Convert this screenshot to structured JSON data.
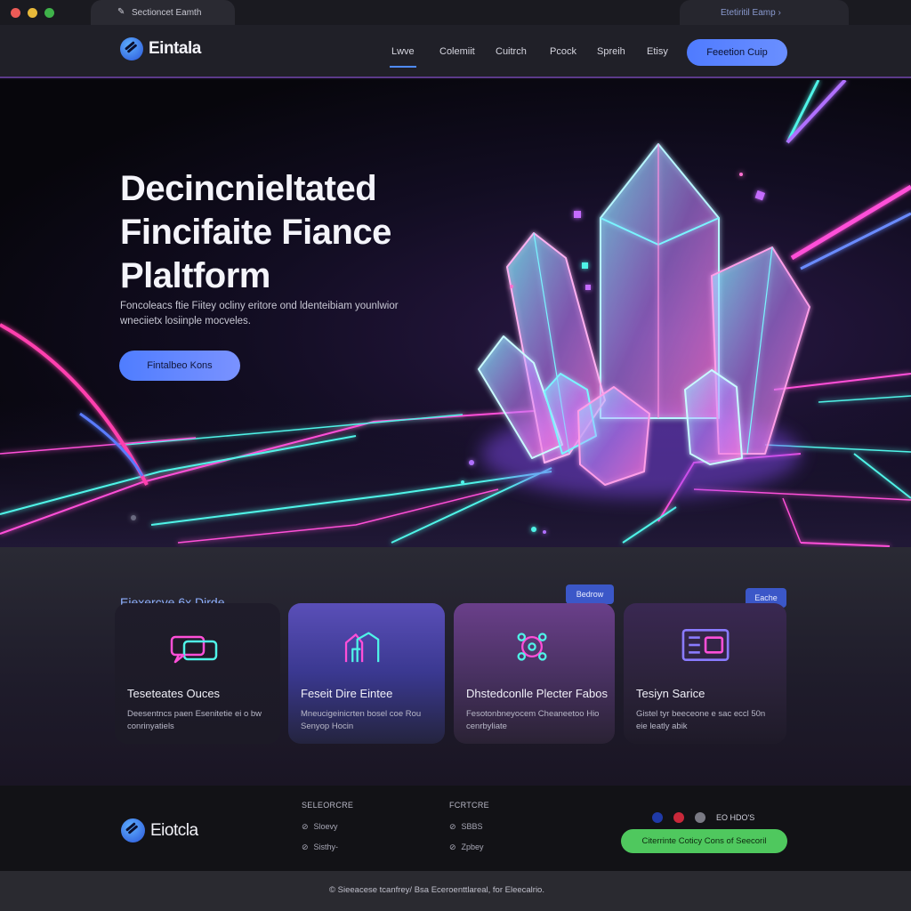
{
  "browser": {
    "tab_title": "Sectioncet Eamth",
    "tab_right": "Etetiritil Eamp"
  },
  "nav": {
    "brand": "Eintala",
    "links": [
      "Lwve",
      "Colemiit",
      "Cuitrch",
      "Pcock",
      "Spreih",
      "Etisy"
    ],
    "active_index": 0,
    "cta": "Feeetion Cuip"
  },
  "hero": {
    "title_lines": [
      "Decincnieltated",
      "Fincifaite Fiance",
      "Plaltform"
    ],
    "description": "Foncoleacs ftie Fiitey ocliny eritore ond ldenteibiam younlwior wneciietx losiinple mocveles.",
    "cta": "Fintalbeo Kons"
  },
  "features": {
    "heading": "Eiexercye 6x Dirde",
    "badges": [
      "Bedrow",
      "Eache"
    ],
    "cards": [
      {
        "title": "Teseteates Ouces",
        "desc": "Deesentncs paen Esenitetie ei o bw conrinyatiels",
        "icon": "dual-chat-icon"
      },
      {
        "title": "Feseit Dire Eintee",
        "desc": "Mneucigeinicrten bosel coe Rou Senyop Hocin",
        "icon": "building-icon"
      },
      {
        "title": "Dhstedconlle Plecter Fabos",
        "desc": "Fesotonbneyocem Cheaneetoo Hio cenrbyliate",
        "icon": "network-icon"
      },
      {
        "title": "Tesiyn Sarice",
        "desc": "Gistel tyr beeceone e sac eccl 50n eie leatly abik",
        "icon": "wallet-icon"
      }
    ]
  },
  "footer": {
    "brand": "Eiotcla",
    "col1": {
      "head": "SELEORCRE",
      "items": [
        "Sloevy",
        "Sisthy-"
      ]
    },
    "col2": {
      "head": "FCRTCRE",
      "items": [
        "SBBS",
        "Zpbey"
      ]
    },
    "social_label": "EO HDO'S",
    "green_button": "Citerrinte Coticy      Cons  of Seecoril",
    "copyright": "Sieeacese tcanfrey/ Bsa Eceroenttlareal, for Eleecalrio."
  },
  "colors": {
    "accent": "#4f7bff",
    "green": "#4fc85e",
    "neon_pink": "#ff4fd8",
    "neon_cyan": "#4ff4e8"
  }
}
